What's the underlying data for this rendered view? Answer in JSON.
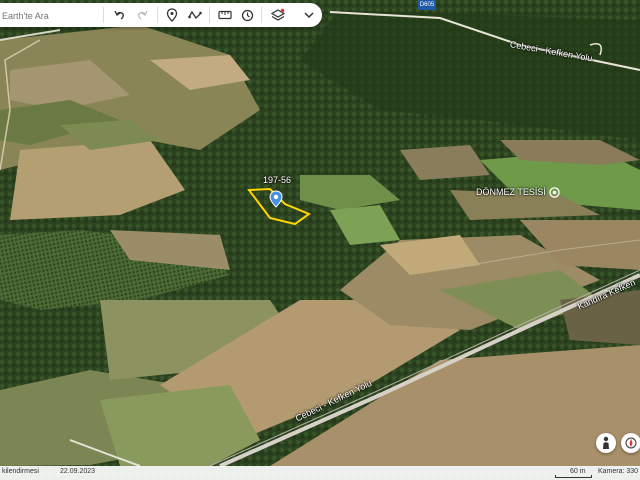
{
  "search": {
    "placeholder": "Earth'te Ara"
  },
  "toolbar": {
    "undo": "undo-icon",
    "redo": "redo-icon",
    "place": "map-pin-icon",
    "path": "path-icon",
    "ruler": "measure-icon",
    "history": "history-icon",
    "layers": "layers-icon",
    "more": "chevron-down-icon"
  },
  "map_labels": {
    "parcel": "197-56",
    "poi": "DÖNMEZ TESİSİ",
    "road_top": "Cebeci - Kefken Yolu",
    "road_bottom": "Cebeci - Kefken Yolu",
    "road_right": "Kandıra Kefken",
    "route_shield": "D605"
  },
  "status": {
    "attribution": "kilendirmesi",
    "date": "22.09.2023",
    "scale": "60 m",
    "camera": "Kamera: 330"
  },
  "side_buttons": {
    "street_view": "person-icon",
    "compass": "compass-icon",
    "extra": "1€"
  },
  "colors": {
    "parcel_outline": "#ffd400",
    "pin": "#4a90e2"
  }
}
